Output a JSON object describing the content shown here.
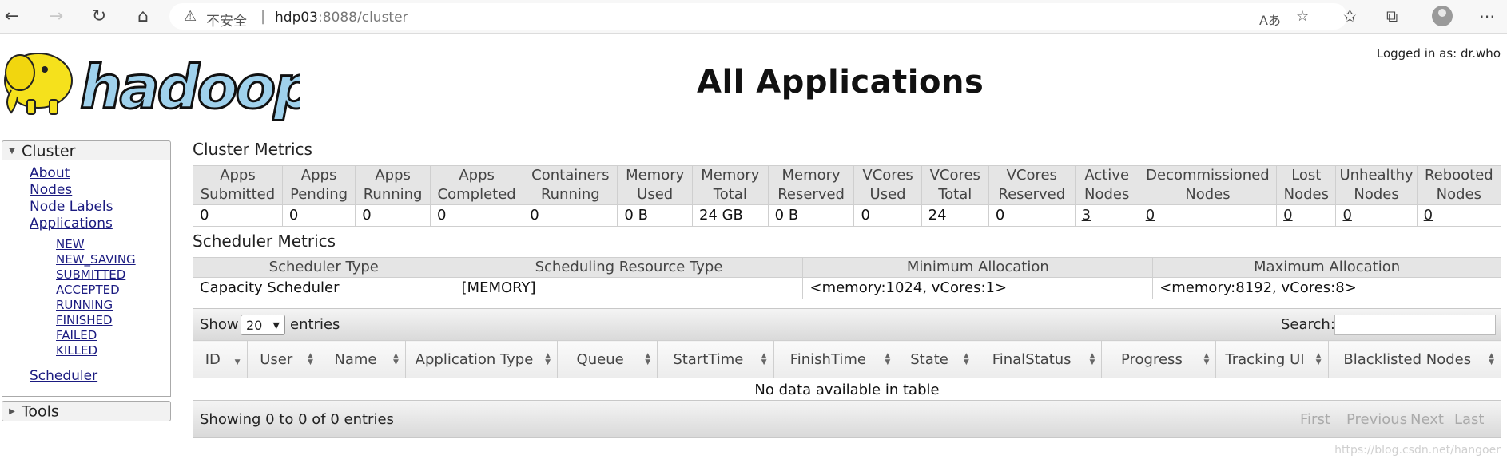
{
  "browser": {
    "insecure_label": "不安全",
    "url_host": "hdp03",
    "url_rest": ":8088/cluster",
    "icons": [
      "back-icon",
      "forward-icon",
      "reload-icon",
      "home-icon",
      "warning-icon",
      "read-aloud-icon",
      "add-favorite-icon",
      "favorites-icon",
      "collections-icon",
      "profile-icon",
      "more-icon"
    ]
  },
  "header": {
    "logged_in": "Logged in as: dr.who",
    "title": "All Applications"
  },
  "sidebar": {
    "cluster_label": "Cluster",
    "links": [
      "About",
      "Nodes",
      "Node Labels",
      "Applications"
    ],
    "app_states": [
      "NEW",
      "NEW_SAVING",
      "SUBMITTED",
      "ACCEPTED",
      "RUNNING",
      "FINISHED",
      "FAILED",
      "KILLED"
    ],
    "scheduler_label": "Scheduler",
    "tools_label": "Tools"
  },
  "cluster_metrics": {
    "title": "Cluster Metrics",
    "headers": [
      [
        "Apps",
        "Submitted"
      ],
      [
        "Apps",
        "Pending"
      ],
      [
        "Apps",
        "Running"
      ],
      [
        "Apps",
        "Completed"
      ],
      [
        "Containers",
        "Running"
      ],
      [
        "Memory",
        "Used"
      ],
      [
        "Memory",
        "Total"
      ],
      [
        "Memory",
        "Reserved"
      ],
      [
        "VCores",
        "Used"
      ],
      [
        "VCores",
        "Total"
      ],
      [
        "VCores",
        "Reserved"
      ],
      [
        "Active",
        "Nodes"
      ],
      [
        "Decommissioned",
        "Nodes"
      ],
      [
        "Lost",
        "Nodes"
      ],
      [
        "Unhealthy",
        "Nodes"
      ],
      [
        "Rebooted",
        "Nodes"
      ]
    ],
    "values": [
      "0",
      "0",
      "0",
      "0",
      "0",
      "0 B",
      "24 GB",
      "0 B",
      "0",
      "24",
      "0",
      "3",
      "0",
      "0",
      "0",
      "0"
    ]
  },
  "scheduler_metrics": {
    "title": "Scheduler Metrics",
    "headers": [
      "Scheduler Type",
      "Scheduling Resource Type",
      "Minimum Allocation",
      "Maximum Allocation"
    ],
    "values": [
      "Capacity Scheduler",
      "[MEMORY]",
      "<memory:1024, vCores:1>",
      "<memory:8192, vCores:8>"
    ]
  },
  "apps_table": {
    "show_label": "Show",
    "entries_value": "20",
    "entries_label": "entries",
    "search_label": "Search:",
    "columns": [
      "ID",
      "User",
      "Name",
      "Application Type",
      "Queue",
      "StartTime",
      "FinishTime",
      "State",
      "FinalStatus",
      "Progress",
      "Tracking UI",
      "Blacklisted Nodes"
    ],
    "empty_message": "No data available in table",
    "info": "Showing 0 to 0 of 0 entries",
    "pager": [
      "First",
      "Previous",
      "Next",
      "Last"
    ]
  },
  "watermark": "https://blog.csdn.net/hangoer"
}
